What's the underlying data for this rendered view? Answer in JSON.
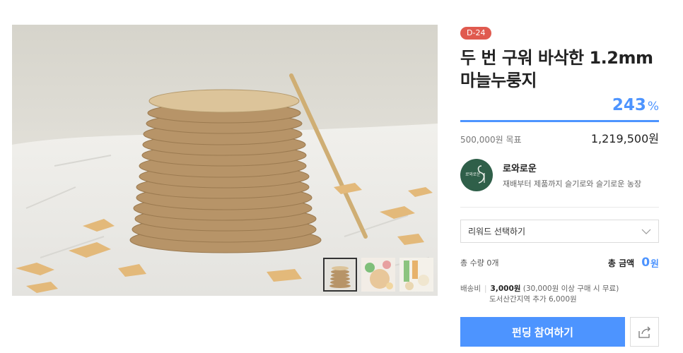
{
  "product": {
    "dday_badge": "D-24",
    "title_line1": "두 번 구워 바삭한 1.2mm",
    "title_line2": "마늘누룽지",
    "percent": "243",
    "percent_symbol": "%",
    "progress_fraction": 1.0,
    "goal_label": "500,000원 목표",
    "raised_amount": "1,219,500원"
  },
  "maker": {
    "logo_text": "로와로운",
    "name": "로와로운",
    "description": "재배부터 제품까지 슬기로와 슬기로운 농장"
  },
  "reward_select": {
    "label": "리워드 선택하기"
  },
  "totals": {
    "quantity": "총 수량  0개",
    "amount_label": "총 금액",
    "amount_value": "0",
    "amount_unit": "원"
  },
  "shipping": {
    "label": "배송비",
    "fee": "3,000원",
    "condition": "(30,000원 이상 구매 시 무료)",
    "extra": "도서산간지역 추가 6,000원"
  },
  "actions": {
    "cta_label": "펀딩 참여하기"
  },
  "icons": {
    "dropdown": "chevron-down-icon",
    "share": "share-icon"
  },
  "colors": {
    "accent": "#4d94ff",
    "badge": "#e05a4f",
    "logo": "#2f5f49"
  }
}
